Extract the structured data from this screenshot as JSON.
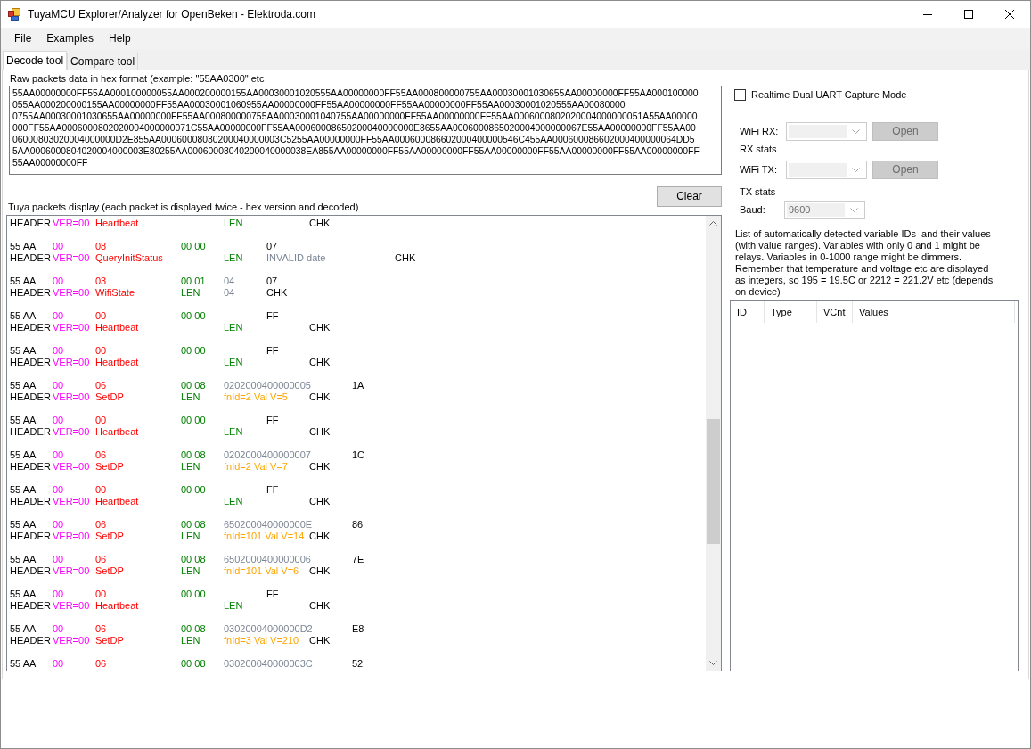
{
  "window": {
    "title": "TuyaMCU Explorer/Analyzer for OpenBeken - Elektroda.com"
  },
  "menu": [
    "File",
    "Examples",
    "Help"
  ],
  "tabs": [
    {
      "label": "Decode tool",
      "selected": true
    },
    {
      "label": "Compare tool",
      "selected": false
    }
  ],
  "raw_input": {
    "label": "Raw packets data in hex format (example: \"55AA0300\" etc",
    "lines": [
      "55AA00000000FF55AA000100000055AA000200000155AA00030001020555AA00000000FF55AA000800000755AA00030001030655AA00000000FF55AA000100000",
      "055AA000200000155AA00000000FF55AA00030001060955AA00000000FF55AA00000000FF55AA00000000FF55AA00030001020555AA00080000",
      "0755AA00030001030655AA00000000FF55AA000800000755AA00030001040755AA00000000FF55AA00000000FF55AA0006000802020004000000051A55AA00000",
      "000FF55AA0006000802020004000000071C55AA00000000FF55AA00060008650200040000000E8655AA0006000865020004000000067E55AA00000000FF55AA00",
      "06000803020004000000D2E855AA00060008030200040000003C5255AA00000000FF55AA000600086602000400000546C455AA000600086602000400000064DD5",
      "5AA0006000804020004000003E80255AA00060008040200040000038EA855AA00000000FF55AA00000000FF55AA00000000FF55AA00000000FF55AA00000000FF",
      "55AA00000000FF"
    ]
  },
  "clear_button": "Clear",
  "packet_display": {
    "label": "Tuya packets display (each packet is displayed twice - hex version and decoded)",
    "packets": [
      {
        "lines": [
          [
            {
              "kind": "header",
              "text": "HEADER"
            },
            {
              "kind": "version",
              "text": "VER=00"
            },
            {
              "kind": "command",
              "text": "Heartbeat"
            },
            {
              "kind": "length",
              "text": "LEN"
            },
            {
              "kind": "checksum",
              "text": "CHK"
            }
          ]
        ]
      },
      {
        "lines": [
          [
            {
              "kind": "header",
              "text": "55 AA"
            },
            {
              "kind": "version",
              "text": "00"
            },
            {
              "kind": "command",
              "text": "08"
            },
            {
              "kind": "length",
              "text": "00 00"
            },
            {
              "kind": "checksum",
              "text": "07"
            }
          ],
          [
            {
              "kind": "header",
              "text": "HEADER"
            },
            {
              "kind": "version",
              "text": "VER=00"
            },
            {
              "kind": "command",
              "text": "QueryInitStatus"
            },
            {
              "kind": "length",
              "text": "LEN"
            },
            {
              "kind": "error",
              "text": "INVALID date"
            },
            {
              "kind": "checksum",
              "text": "CHK"
            }
          ]
        ]
      },
      {
        "lines": [
          [
            {
              "kind": "header",
              "text": "55 AA"
            },
            {
              "kind": "version",
              "text": "00"
            },
            {
              "kind": "command",
              "text": "03"
            },
            {
              "kind": "length",
              "text": "00 01"
            },
            {
              "kind": "payload",
              "text": "04"
            },
            {
              "kind": "checksum",
              "text": "07"
            }
          ],
          [
            {
              "kind": "header",
              "text": "HEADER"
            },
            {
              "kind": "version",
              "text": "VER=00"
            },
            {
              "kind": "command",
              "text": "WifiState"
            },
            {
              "kind": "length",
              "text": "LEN"
            },
            {
              "kind": "payload",
              "text": "04"
            },
            {
              "kind": "checksum",
              "text": "CHK"
            }
          ]
        ]
      },
      {
        "lines": [
          [
            {
              "kind": "header",
              "text": "55 AA"
            },
            {
              "kind": "version",
              "text": "00"
            },
            {
              "kind": "command",
              "text": "00"
            },
            {
              "kind": "length",
              "text": "00 00"
            },
            {
              "kind": "checksum",
              "text": "FF"
            }
          ],
          [
            {
              "kind": "header",
              "text": "HEADER"
            },
            {
              "kind": "version",
              "text": "VER=00"
            },
            {
              "kind": "command",
              "text": "Heartbeat"
            },
            {
              "kind": "length",
              "text": "LEN"
            },
            {
              "kind": "checksum",
              "text": "CHK"
            }
          ]
        ]
      },
      {
        "lines": [
          [
            {
              "kind": "header",
              "text": "55 AA"
            },
            {
              "kind": "version",
              "text": "00"
            },
            {
              "kind": "command",
              "text": "00"
            },
            {
              "kind": "length",
              "text": "00 00"
            },
            {
              "kind": "checksum",
              "text": "FF"
            }
          ],
          [
            {
              "kind": "header",
              "text": "HEADER"
            },
            {
              "kind": "version",
              "text": "VER=00"
            },
            {
              "kind": "command",
              "text": "Heartbeat"
            },
            {
              "kind": "length",
              "text": "LEN"
            },
            {
              "kind": "checksum",
              "text": "CHK"
            }
          ]
        ]
      },
      {
        "lines": [
          [
            {
              "kind": "header",
              "text": "55 AA"
            },
            {
              "kind": "version",
              "text": "00"
            },
            {
              "kind": "command",
              "text": "06"
            },
            {
              "kind": "length",
              "text": "00 08"
            },
            {
              "kind": "payload",
              "text": "0202000400000005"
            },
            {
              "kind": "checksum",
              "text": "1A"
            }
          ],
          [
            {
              "kind": "header",
              "text": "HEADER"
            },
            {
              "kind": "version",
              "text": "VER=00"
            },
            {
              "kind": "command",
              "text": "SetDP"
            },
            {
              "kind": "length",
              "text": "LEN"
            },
            {
              "kind": "decoded",
              "text": "fnId=2 Val V=5"
            },
            {
              "kind": "checksum",
              "text": "CHK"
            }
          ]
        ]
      },
      {
        "lines": [
          [
            {
              "kind": "header",
              "text": "55 AA"
            },
            {
              "kind": "version",
              "text": "00"
            },
            {
              "kind": "command",
              "text": "00"
            },
            {
              "kind": "length",
              "text": "00 00"
            },
            {
              "kind": "checksum",
              "text": "FF"
            }
          ],
          [
            {
              "kind": "header",
              "text": "HEADER"
            },
            {
              "kind": "version",
              "text": "VER=00"
            },
            {
              "kind": "command",
              "text": "Heartbeat"
            },
            {
              "kind": "length",
              "text": "LEN"
            },
            {
              "kind": "checksum",
              "text": "CHK"
            }
          ]
        ]
      },
      {
        "lines": [
          [
            {
              "kind": "header",
              "text": "55 AA"
            },
            {
              "kind": "version",
              "text": "00"
            },
            {
              "kind": "command",
              "text": "06"
            },
            {
              "kind": "length",
              "text": "00 08"
            },
            {
              "kind": "payload",
              "text": "0202000400000007"
            },
            {
              "kind": "checksum",
              "text": "1C"
            }
          ],
          [
            {
              "kind": "header",
              "text": "HEADER"
            },
            {
              "kind": "version",
              "text": "VER=00"
            },
            {
              "kind": "command",
              "text": "SetDP"
            },
            {
              "kind": "length",
              "text": "LEN"
            },
            {
              "kind": "decoded",
              "text": "fnId=2 Val V=7"
            },
            {
              "kind": "checksum",
              "text": "CHK"
            }
          ]
        ]
      },
      {
        "lines": [
          [
            {
              "kind": "header",
              "text": "55 AA"
            },
            {
              "kind": "version",
              "text": "00"
            },
            {
              "kind": "command",
              "text": "00"
            },
            {
              "kind": "length",
              "text": "00 00"
            },
            {
              "kind": "checksum",
              "text": "FF"
            }
          ],
          [
            {
              "kind": "header",
              "text": "HEADER"
            },
            {
              "kind": "version",
              "text": "VER=00"
            },
            {
              "kind": "command",
              "text": "Heartbeat"
            },
            {
              "kind": "length",
              "text": "LEN"
            },
            {
              "kind": "checksum",
              "text": "CHK"
            }
          ]
        ]
      },
      {
        "lines": [
          [
            {
              "kind": "header",
              "text": "55 AA"
            },
            {
              "kind": "version",
              "text": "00"
            },
            {
              "kind": "command",
              "text": "06"
            },
            {
              "kind": "length",
              "text": "00 08"
            },
            {
              "kind": "payload",
              "text": "650200040000000E"
            },
            {
              "kind": "checksum",
              "text": "86"
            }
          ],
          [
            {
              "kind": "header",
              "text": "HEADER"
            },
            {
              "kind": "version",
              "text": "VER=00"
            },
            {
              "kind": "command",
              "text": "SetDP"
            },
            {
              "kind": "length",
              "text": "LEN"
            },
            {
              "kind": "decoded",
              "text": "fnId=101 Val V=14"
            },
            {
              "kind": "checksum",
              "text": "CHK"
            }
          ]
        ]
      },
      {
        "lines": [
          [
            {
              "kind": "header",
              "text": "55 AA"
            },
            {
              "kind": "version",
              "text": "00"
            },
            {
              "kind": "command",
              "text": "06"
            },
            {
              "kind": "length",
              "text": "00 08"
            },
            {
              "kind": "payload",
              "text": "6502000400000006"
            },
            {
              "kind": "checksum",
              "text": "7E"
            }
          ],
          [
            {
              "kind": "header",
              "text": "HEADER"
            },
            {
              "kind": "version",
              "text": "VER=00"
            },
            {
              "kind": "command",
              "text": "SetDP"
            },
            {
              "kind": "length",
              "text": "LEN"
            },
            {
              "kind": "decoded",
              "text": "fnId=101 Val V=6"
            },
            {
              "kind": "checksum",
              "text": "CHK"
            }
          ]
        ]
      },
      {
        "lines": [
          [
            {
              "kind": "header",
              "text": "55 AA"
            },
            {
              "kind": "version",
              "text": "00"
            },
            {
              "kind": "command",
              "text": "00"
            },
            {
              "kind": "length",
              "text": "00 00"
            },
            {
              "kind": "checksum",
              "text": "FF"
            }
          ],
          [
            {
              "kind": "header",
              "text": "HEADER"
            },
            {
              "kind": "version",
              "text": "VER=00"
            },
            {
              "kind": "command",
              "text": "Heartbeat"
            },
            {
              "kind": "length",
              "text": "LEN"
            },
            {
              "kind": "checksum",
              "text": "CHK"
            }
          ]
        ]
      },
      {
        "lines": [
          [
            {
              "kind": "header",
              "text": "55 AA"
            },
            {
              "kind": "version",
              "text": "00"
            },
            {
              "kind": "command",
              "text": "06"
            },
            {
              "kind": "length",
              "text": "00 08"
            },
            {
              "kind": "payload",
              "text": "03020004000000D2"
            },
            {
              "kind": "checksum",
              "text": "E8"
            }
          ],
          [
            {
              "kind": "header",
              "text": "HEADER"
            },
            {
              "kind": "version",
              "text": "VER=00"
            },
            {
              "kind": "command",
              "text": "SetDP"
            },
            {
              "kind": "length",
              "text": "LEN"
            },
            {
              "kind": "decoded",
              "text": "fnId=3 Val V=210"
            },
            {
              "kind": "checksum",
              "text": "CHK"
            }
          ]
        ]
      },
      {
        "lines": [
          [
            {
              "kind": "header",
              "text": "55 AA"
            },
            {
              "kind": "version",
              "text": "00"
            },
            {
              "kind": "command",
              "text": "06"
            },
            {
              "kind": "length",
              "text": "00 08"
            },
            {
              "kind": "payload",
              "text": "030200040000003C"
            },
            {
              "kind": "checksum",
              "text": "52"
            }
          ]
        ]
      }
    ]
  },
  "capture": {
    "label": "Realtime Dual UART Capture Mode",
    "checked": false
  },
  "ports": [
    {
      "label": "WiFi RX:",
      "disabled": true,
      "button": {
        "label": "Open",
        "disabled": true
      },
      "stats": "RX stats"
    },
    {
      "label": "WiFi TX:",
      "disabled": true,
      "button": {
        "label": "Open",
        "disabled": true
      },
      "stats": "TX stats"
    }
  ],
  "baud": {
    "label": "Baud:",
    "value": "9600",
    "disabled": true
  },
  "variables": {
    "description": "List of automatically detected variable IDs  and their values (with value ranges). Variables with only 0 and 1 might be relays. Variables in 0-1000 range might be dimmers. Remember that temperature and voltage etc are displayed as integers, so 195 = 19.5C or 2212 = 221.2V etc (depends on device)",
    "columns": [
      "ID",
      "Type",
      "VCnt",
      "Values"
    ]
  }
}
